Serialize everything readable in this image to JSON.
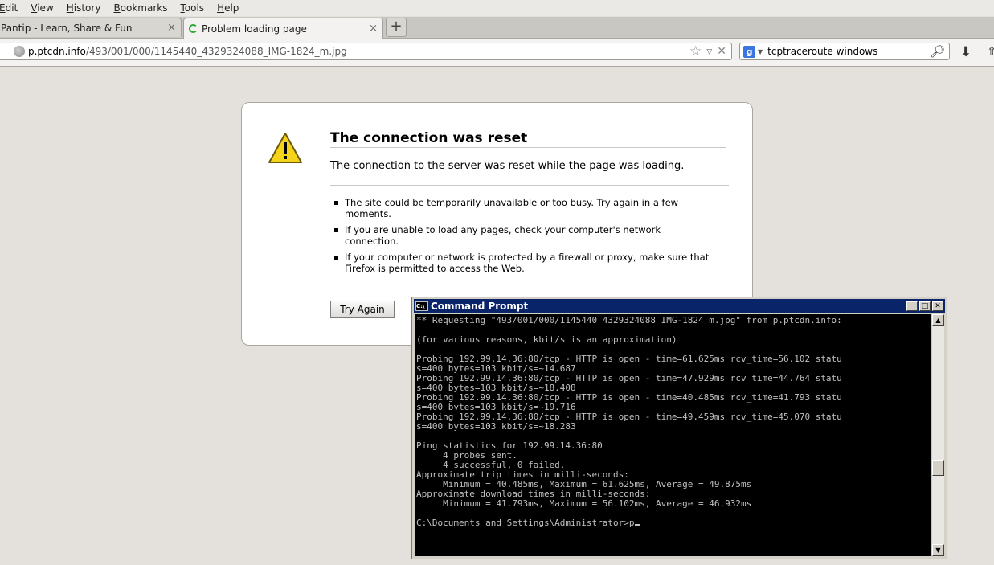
{
  "menubar": {
    "items": [
      {
        "underline": "E",
        "rest": "dit"
      },
      {
        "underline": "V",
        "rest": "iew"
      },
      {
        "underline": "H",
        "rest": "istory"
      },
      {
        "underline": "B",
        "rest": "ookmarks"
      },
      {
        "underline": "T",
        "rest": "ools"
      },
      {
        "underline": "H",
        "rest": "elp"
      }
    ]
  },
  "tabs": [
    {
      "title": "Pantip - Learn, Share & Fun",
      "close": "×"
    },
    {
      "title": "Problem loading page",
      "close": "×"
    }
  ],
  "new_tab": "+",
  "navbar": {
    "url_host": "p.ptcdn.info",
    "url_path": "/493/001/000/1145440_4329324088_IMG-1824_m.jpg",
    "search_engine_letter": "g",
    "search_query": "tcptraceroute windows"
  },
  "error_page": {
    "title": "The connection was reset",
    "description": "The connection to the server was reset while the page was loading.",
    "reasons": [
      "The site could be temporarily unavailable or too busy. Try again in a few moments.",
      "If you are unable to load any pages, check your computer's network connection.",
      "If your computer or network is protected by a firewall or proxy, make sure that Firefox is permitted to access the Web."
    ],
    "try_again_label": "Try Again"
  },
  "cmd": {
    "title": "Command Prompt",
    "icon_text": "C:\\",
    "output": "** Requesting \"493/001/000/1145440_4329324088_IMG-1824_m.jpg\" from p.ptcdn.info:\n\n(for various reasons, kbit/s is an approximation)\n\nProbing 192.99.14.36:80/tcp - HTTP is open - time=61.625ms rcv_time=56.102 statu\ns=400 bytes=103 kbit/s=~14.687\nProbing 192.99.14.36:80/tcp - HTTP is open - time=47.929ms rcv_time=44.764 statu\ns=400 bytes=103 kbit/s=~18.408\nProbing 192.99.14.36:80/tcp - HTTP is open - time=40.485ms rcv_time=41.793 statu\ns=400 bytes=103 kbit/s=~19.716\nProbing 192.99.14.36:80/tcp - HTTP is open - time=49.459ms rcv_time=45.070 statu\ns=400 bytes=103 kbit/s=~18.283\n\nPing statistics for 192.99.14.36:80\n     4 probes sent.\n     4 successful, 0 failed.\nApproximate trip times in milli-seconds:\n     Minimum = 40.485ms, Maximum = 61.625ms, Average = 49.875ms\nApproximate download times in milli-seconds:\n     Minimum = 41.793ms, Maximum = 56.102ms, Average = 46.932ms\n\nC:\\Documents and Settings\\Administrator>p",
    "scroll_position": 0.66
  }
}
